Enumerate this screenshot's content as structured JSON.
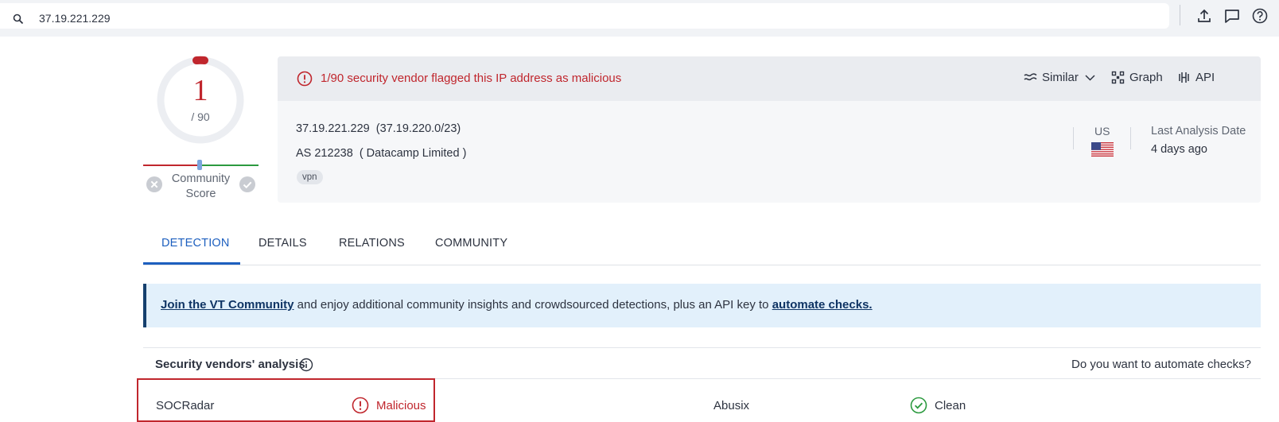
{
  "search": {
    "query": "37.19.221.229",
    "icon": "search-icon"
  },
  "toolbar": {
    "icons": [
      "upload-icon",
      "chat-icon",
      "help-icon"
    ]
  },
  "score": {
    "detections": "1",
    "total": "/ 90",
    "colors": {
      "malicious": "#c0262d",
      "ring": "#eceef2"
    }
  },
  "community": {
    "label": "Community Score",
    "line1": "Community",
    "line2": "Score"
  },
  "summary": {
    "alert": "1/90 security vendor flagged this IP address as malicious",
    "actions": {
      "similar": "Similar",
      "graph": "Graph",
      "api": "API"
    },
    "ip": "37.19.221.229",
    "network": "(37.19.220.0/23)",
    "as_number": "AS 212238",
    "as_owner": "( Datacamp Limited )",
    "tag": "vpn",
    "country": "US",
    "last_analysis_label": "Last Analysis Date",
    "last_analysis_value": "4 days ago"
  },
  "tabs": [
    "DETECTION",
    "DETAILS",
    "RELATIONS",
    "COMMUNITY"
  ],
  "banner": {
    "link1": "Join the VT Community",
    "middle": " and enjoy additional community insights and crowdsourced detections, plus an API key to ",
    "link2": "automate checks."
  },
  "vendors": {
    "title": "Security vendors' analysis",
    "automate_question": "Do you want to automate checks?",
    "rows": [
      {
        "vendor": "SOCRadar",
        "verdict": "Malicious"
      },
      {
        "vendor": "Abusix",
        "verdict": "Clean"
      }
    ]
  }
}
